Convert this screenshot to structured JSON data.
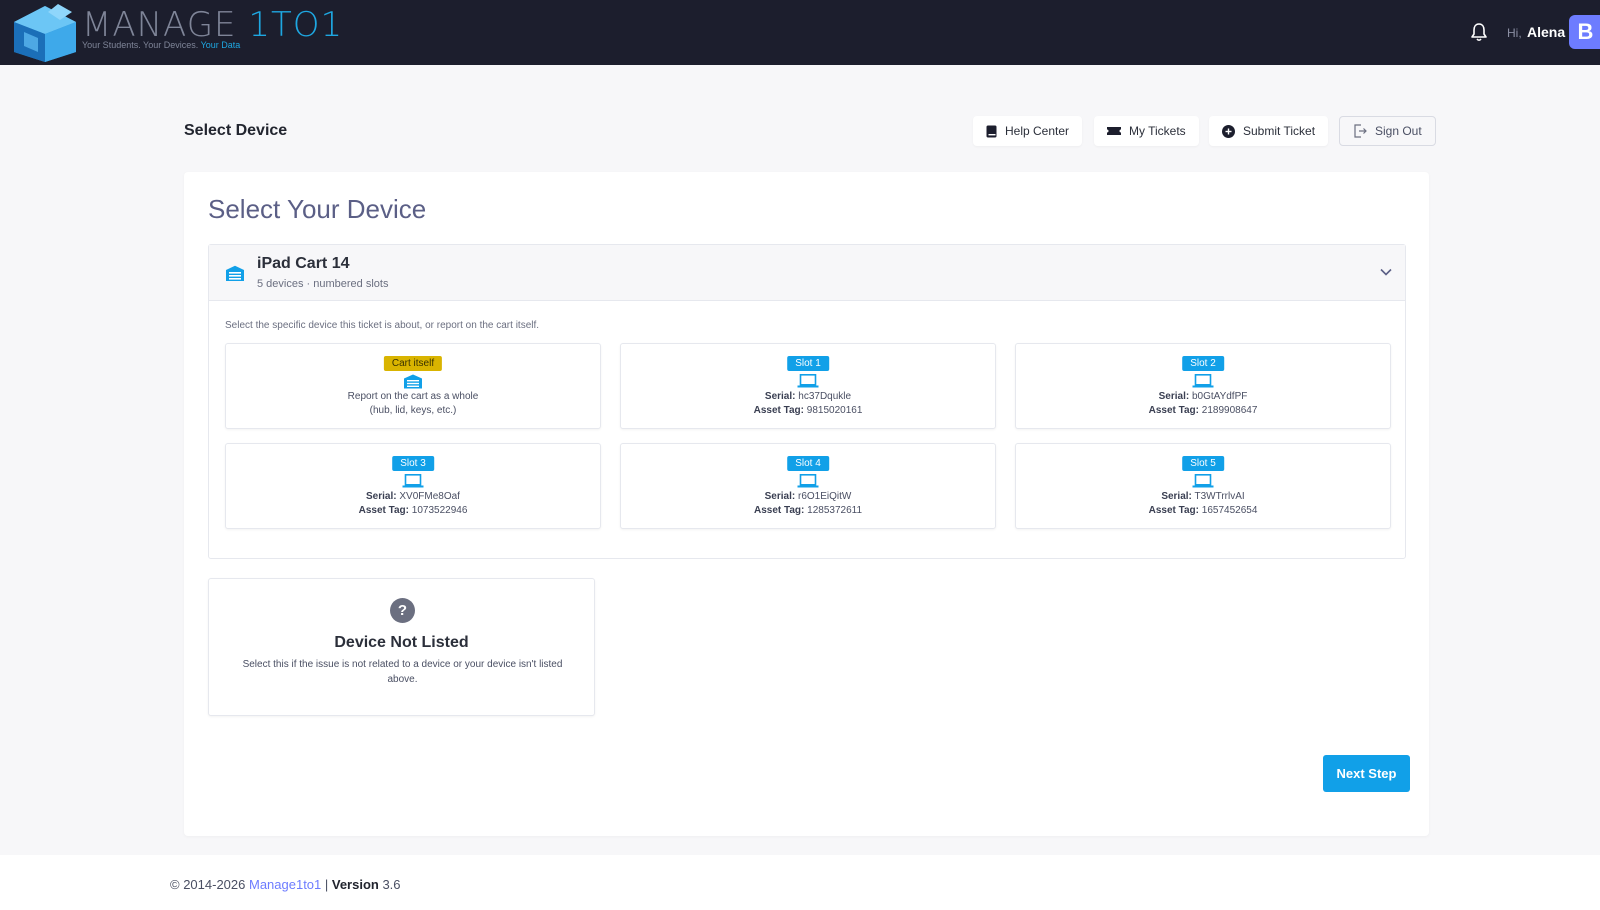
{
  "header": {
    "logo_text_main": "MANAGE ",
    "logo_text_accent": "1TO1",
    "logo_tag_main": "Your Students. Your Devices. ",
    "logo_tag_accent": "Your Data",
    "greeting": "Hi,",
    "user_name": "Alena",
    "avatar_initial": "B"
  },
  "subheader": {
    "title": "Select Device",
    "buttons": {
      "help": "Help Center",
      "tickets": "My Tickets",
      "submit": "Submit Ticket",
      "signout": "Sign Out"
    }
  },
  "main": {
    "heading": "Select Your Device",
    "cart": {
      "name": "iPad Cart 14",
      "subtitle": "5 devices · numbered slots",
      "hint": "Select the specific device this ticket is about, or report on the cart itself.",
      "cart_tile": {
        "badge": "Cart itself",
        "line1": "Report on the cart as a whole",
        "line2": "(hub, lid, keys, etc.)"
      },
      "serial_label": "Serial:",
      "asset_label": "Asset Tag:",
      "slots": [
        {
          "badge": "Slot 1",
          "serial": "hc37Dqukle",
          "asset": "9815020161"
        },
        {
          "badge": "Slot 2",
          "serial": "b0GtAYdfPF",
          "asset": "2189908647"
        },
        {
          "badge": "Slot 3",
          "serial": "XV0FMe8Oaf",
          "asset": "1073522946"
        },
        {
          "badge": "Slot 4",
          "serial": "r6O1EiQitW",
          "asset": "1285372611"
        },
        {
          "badge": "Slot 5",
          "serial": "T3WTrrlvAI",
          "asset": "1657452654"
        }
      ]
    },
    "not_listed": {
      "icon": "?",
      "title": "Device Not Listed",
      "description": "Select this if the issue is not related to a device or your device isn't listed above."
    },
    "next_button": "Next Step"
  },
  "footer": {
    "copyright": "© 2014-2026 ",
    "brand": "Manage1to1",
    "separator": " | ",
    "version_label": "Version",
    "version": " 3.6"
  },
  "colors": {
    "topbar": "#1c1e2d",
    "accent": "#11a0e8",
    "avatar": "#6d7cff",
    "cart_badge": "#d9b400"
  }
}
